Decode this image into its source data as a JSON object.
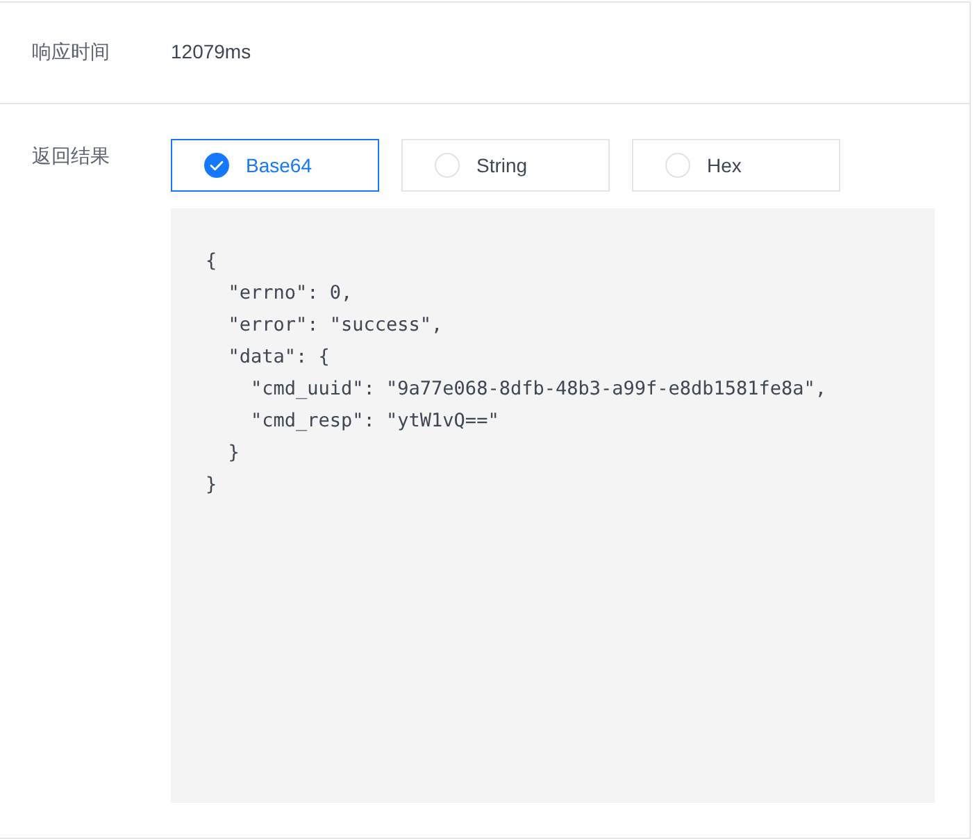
{
  "rows": [
    {
      "label": "响应时间",
      "value": "12079ms"
    },
    {
      "label": "返回结果",
      "format_options": [
        {
          "label": "Base64",
          "selected": true
        },
        {
          "label": "String",
          "selected": false
        },
        {
          "label": "Hex",
          "selected": false
        }
      ],
      "code_lines": [
        "{",
        "  \"errno\": 0,",
        "  \"error\": \"success\",",
        "  \"data\": {",
        "    \"cmd_uuid\": \"9a77e068-8dfb-48b3-a99f-e8db1581fe8a\",",
        "    \"cmd_resp\": \"ytW1vQ==\"",
        "  }",
        "}"
      ]
    }
  ]
}
